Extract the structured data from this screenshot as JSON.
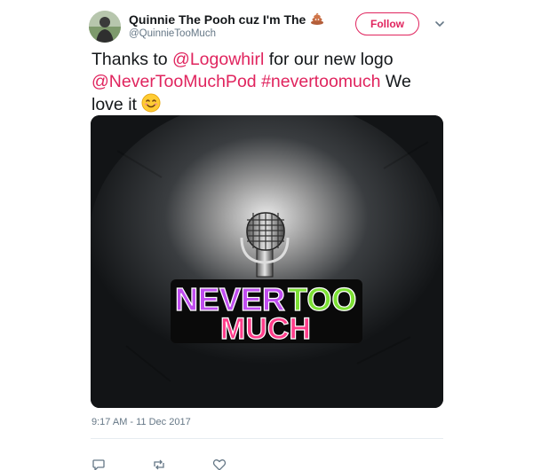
{
  "author": {
    "display_name": "Quinnie The Pooh cuz I'm The",
    "name_emoji_icon": "poop-emoji-icon",
    "handle": "@QuinnieTooMuch"
  },
  "follow_button": {
    "label": "Follow",
    "color": "#e0245e"
  },
  "tweet": {
    "text_prefix": "Thanks to ",
    "mention_logowhirl": "@Logowhirl",
    "text_middle": " for our new logo ",
    "mention_pod": "@NeverTooMuchPod",
    "hashtag": "#nevertoomuch",
    "text_suffix": " We love it",
    "end_emoji_icon": "smiling-face-emoji-icon",
    "link_color": "#e0245e"
  },
  "media": {
    "logo_word_never": "NEVER",
    "logo_word_too": "TOO",
    "logo_word_much": "MUCH",
    "logo_colors": {
      "never": "#c04df0",
      "too": "#7ce033",
      "much": "#ff3d8a"
    }
  },
  "timestamp": "9:17 AM - 11 Dec 2017",
  "actions": [
    "reply-icon",
    "retweet-icon",
    "like-icon"
  ]
}
